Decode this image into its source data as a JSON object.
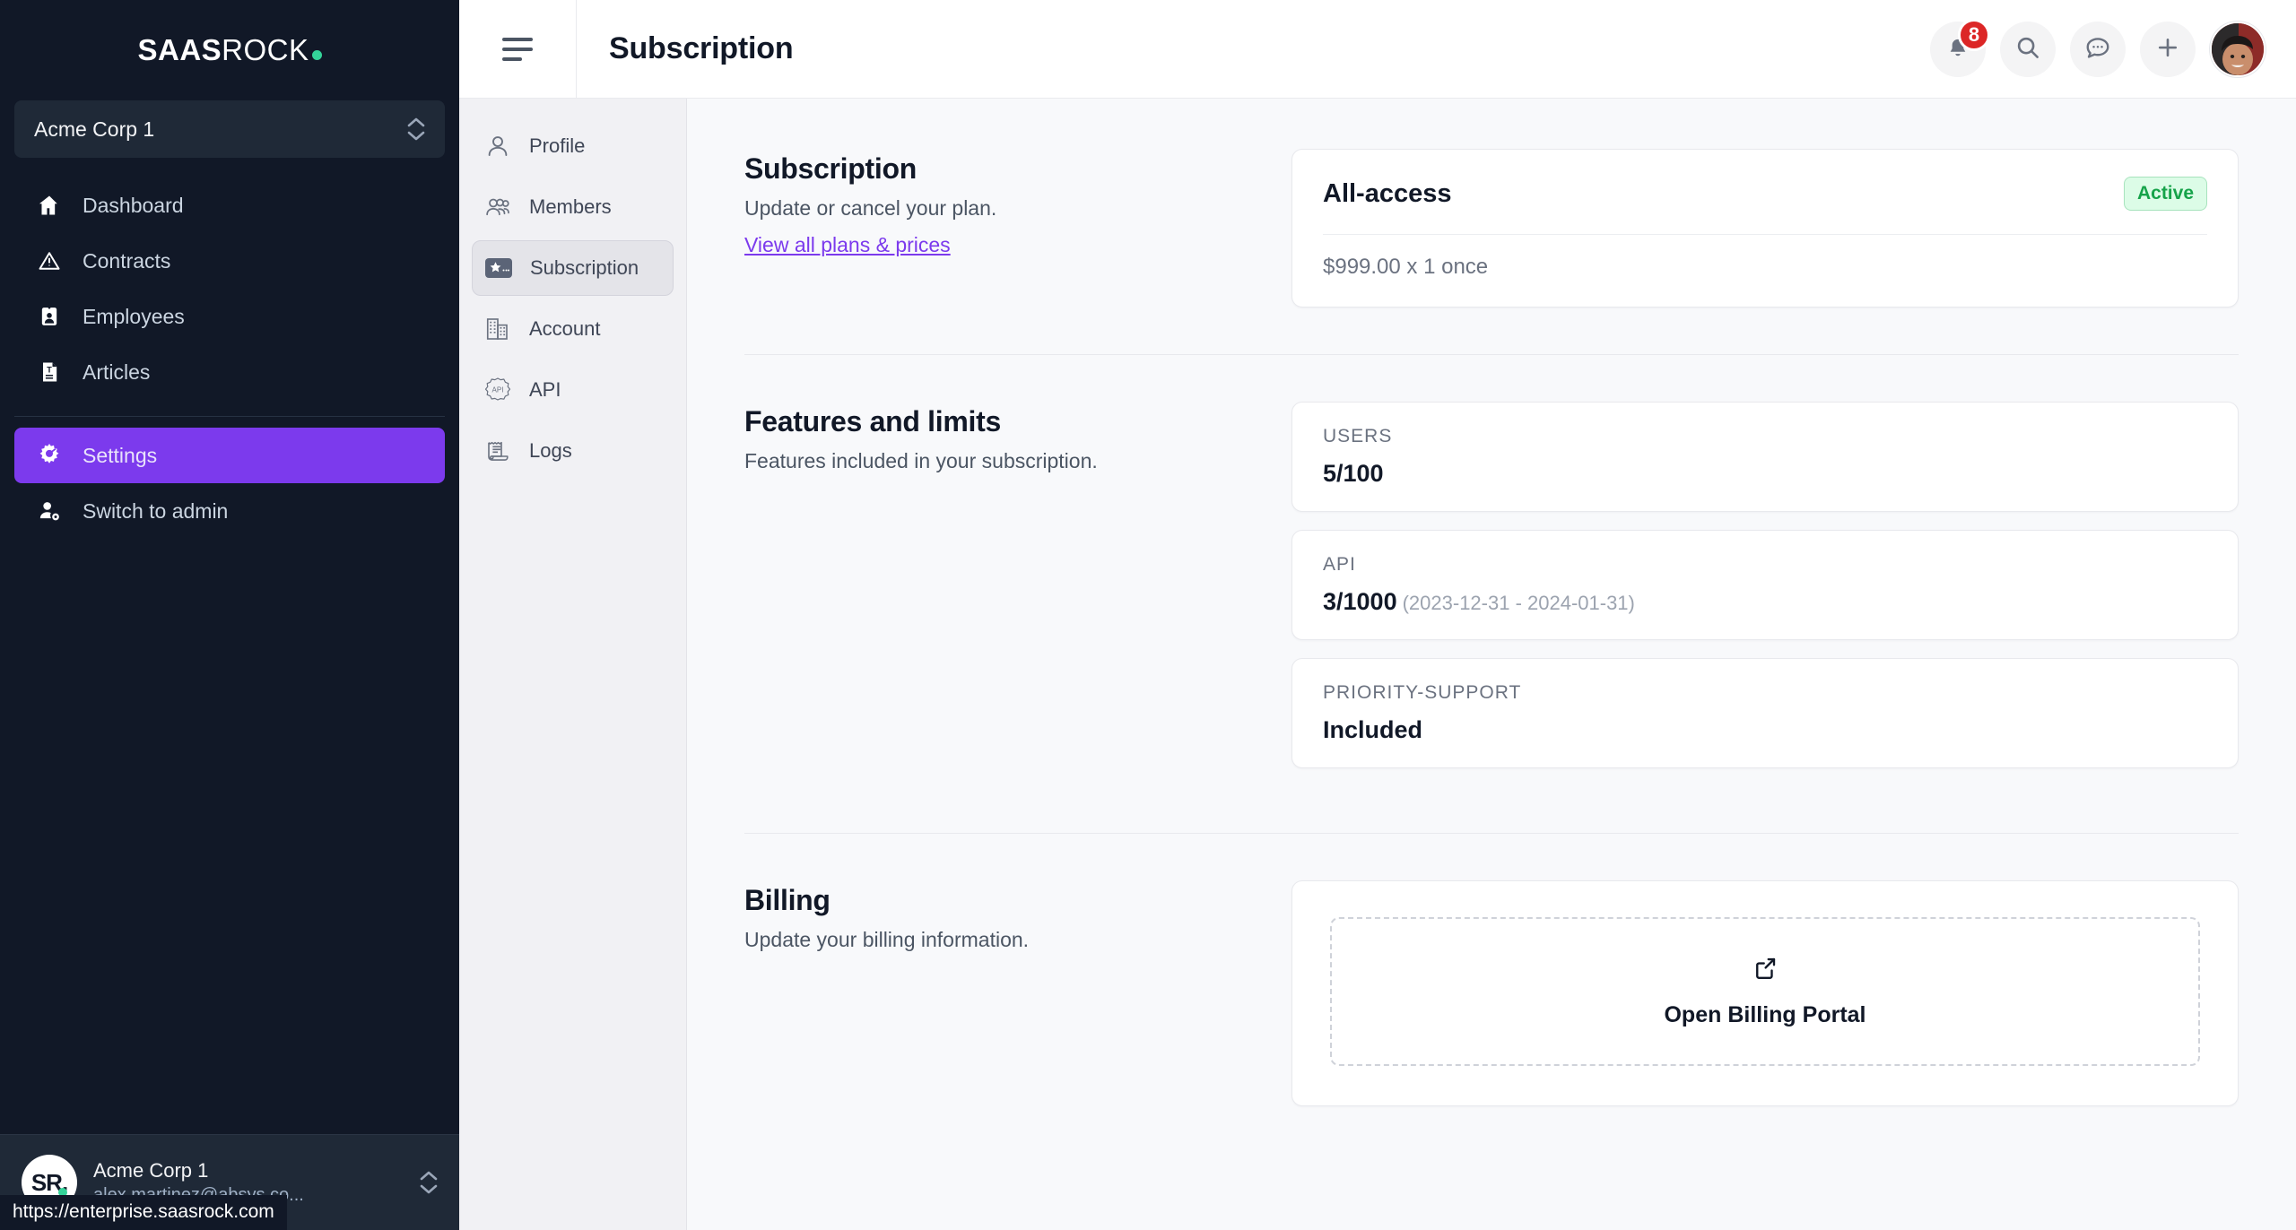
{
  "brand": {
    "bold": "SAAS",
    "light": "ROCK",
    "dot": "green-dot",
    "dot_color": "#34D399"
  },
  "workspace": {
    "name": "Acme Corp 1"
  },
  "sidebar": {
    "items": [
      {
        "label": "Dashboard",
        "icon": "home-icon",
        "active": false
      },
      {
        "label": "Contracts",
        "icon": "warning-triangle-icon",
        "active": false
      },
      {
        "label": "Employees",
        "icon": "id-badge-icon",
        "active": false
      },
      {
        "label": "Articles",
        "icon": "document-text-icon",
        "active": false
      },
      {
        "label": "Settings",
        "icon": "gear-icon",
        "active": true
      },
      {
        "label": "Switch to admin",
        "icon": "user-cog-icon",
        "active": false
      }
    ],
    "active_color": "#7C3AED",
    "account": {
      "initials": "SR.",
      "name": "Acme Corp 1",
      "email": "alex.martinez@absys.co..."
    }
  },
  "statusbar": {
    "url": "https://enterprise.saasrock.com"
  },
  "topbar": {
    "menu_icon": "hamburger-icon",
    "title": "Subscription",
    "actions": [
      {
        "icon": "bell-icon",
        "badge": "8",
        "badge_color": "#DC2626"
      },
      {
        "icon": "search-icon",
        "badge": null
      },
      {
        "icon": "chat-bubble-icon",
        "badge": null
      },
      {
        "icon": "plus-icon",
        "badge": null
      }
    ],
    "avatar": "user-photo-avatar"
  },
  "settings_nav": {
    "items": [
      {
        "label": "Profile",
        "icon": "person-icon",
        "active": false
      },
      {
        "label": "Members",
        "icon": "people-group-icon",
        "active": false
      },
      {
        "label": "Subscription",
        "icon": "star-badge-icon",
        "active": true
      },
      {
        "label": "Account",
        "icon": "buildings-icon",
        "active": false
      },
      {
        "label": "API",
        "icon": "api-badge-icon",
        "active": false
      },
      {
        "label": "Logs",
        "icon": "receipt-scroll-icon",
        "active": false
      }
    ]
  },
  "main": {
    "subscription": {
      "title": "Subscription",
      "description": "Update or cancel your plan.",
      "link": "View all plans & prices",
      "plan_name": "All-access",
      "status": "Active",
      "status_color": "#16A34A",
      "price": "$999.00 x 1 once"
    },
    "features": {
      "title": "Features and limits",
      "description": "Features included in your subscription.",
      "items": [
        {
          "label": "USERS",
          "value": "5/100",
          "range": ""
        },
        {
          "label": "API",
          "value": "3/1000",
          "range": "(2023-12-31 - 2024-01-31)"
        },
        {
          "label": "PRIORITY-SUPPORT",
          "value": "Included",
          "range": ""
        }
      ]
    },
    "billing": {
      "title": "Billing",
      "description": "Update your billing information.",
      "button_label": "Open Billing Portal",
      "button_icon": "external-link-icon"
    }
  }
}
